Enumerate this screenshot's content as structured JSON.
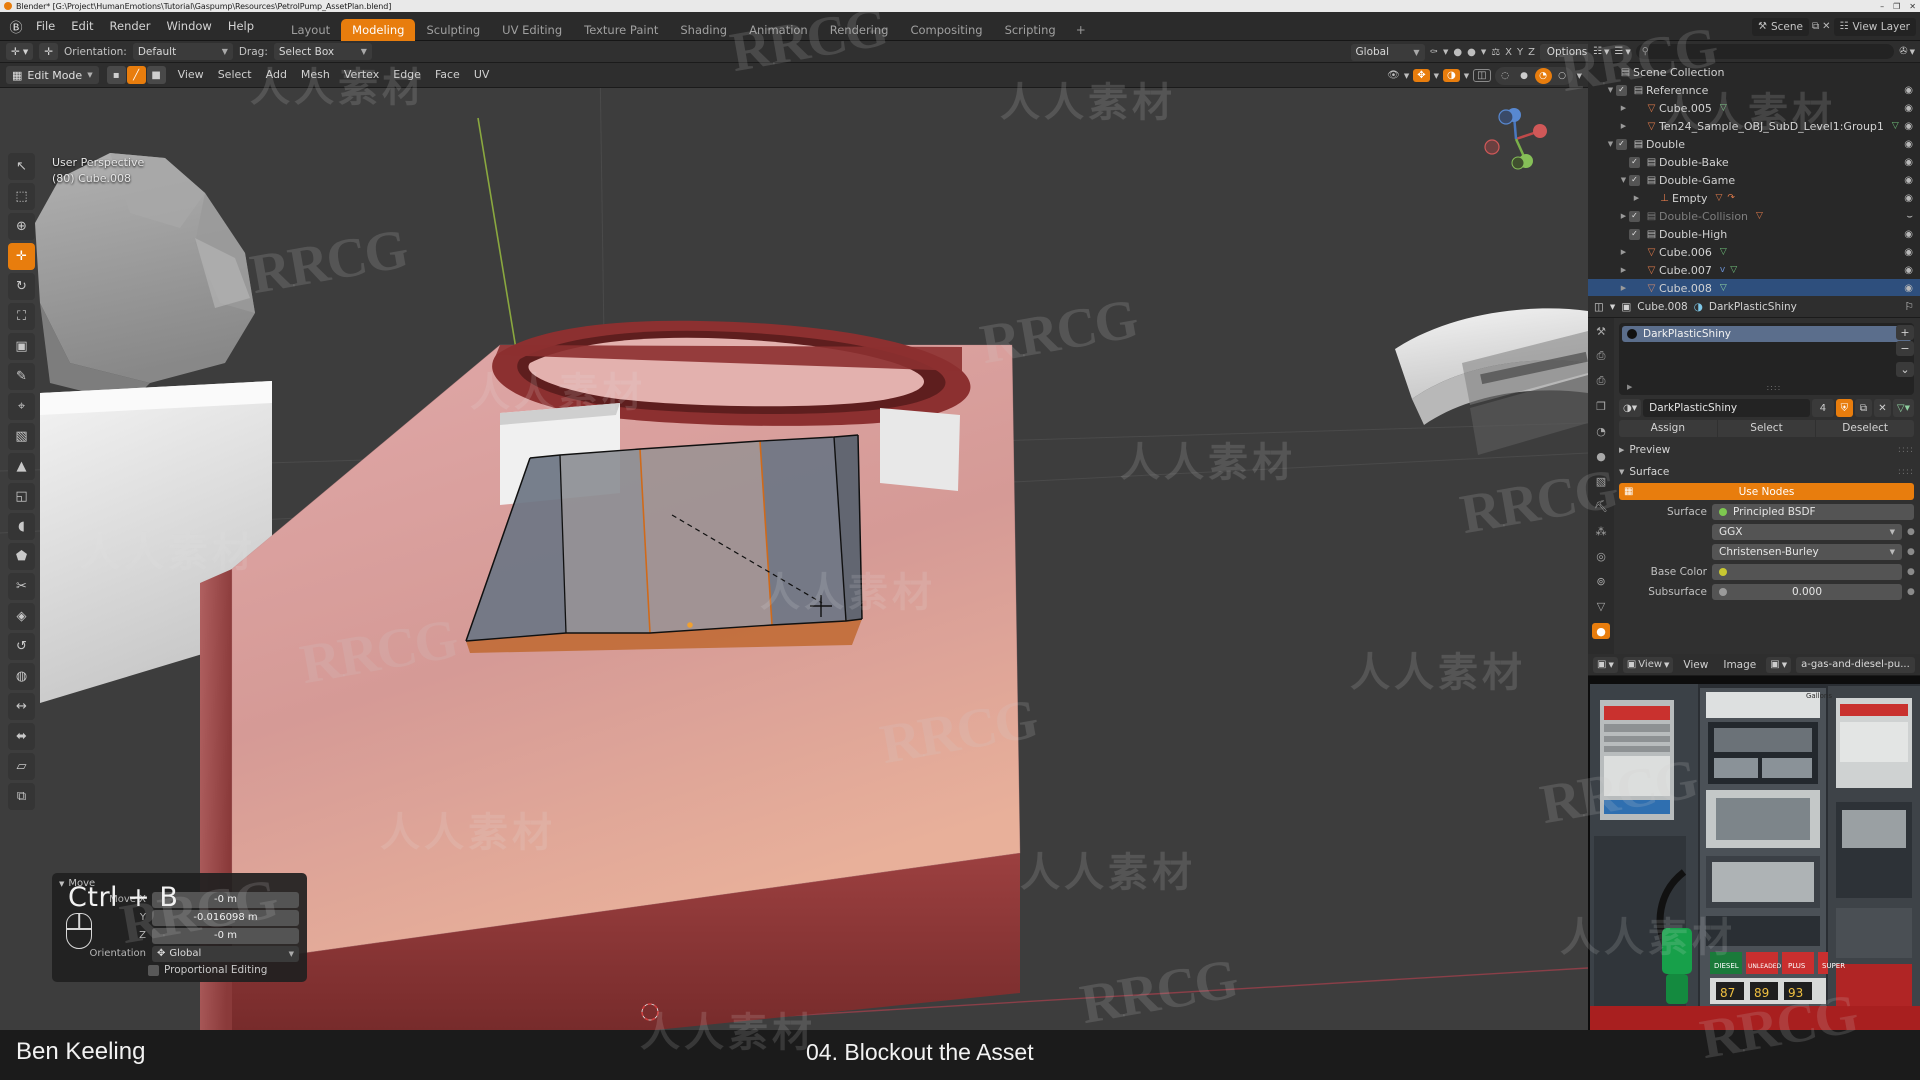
{
  "window": {
    "title": "Blender* [G:\\Project\\HumanEmotions\\Tutorial\\Gaspump\\Resources\\PetrolPump_AssetPlan.blend]",
    "minimize": "–",
    "maximize": "❐",
    "close": "✕"
  },
  "topbar": {
    "logo": "Ⓑ",
    "menus": [
      "File",
      "Edit",
      "Render",
      "Window",
      "Help"
    ],
    "workspaces": [
      {
        "label": "Layout",
        "active": false
      },
      {
        "label": "Modeling",
        "active": true
      },
      {
        "label": "Sculpting",
        "active": false
      },
      {
        "label": "UV Editing",
        "active": false
      },
      {
        "label": "Texture Paint",
        "active": false
      },
      {
        "label": "Shading",
        "active": false
      },
      {
        "label": "Animation",
        "active": false
      },
      {
        "label": "Rendering",
        "active": false
      },
      {
        "label": "Compositing",
        "active": false
      },
      {
        "label": "Scripting",
        "active": false
      }
    ],
    "add_workspace": "+",
    "scene_icon": "⚒",
    "scene_name": "Scene",
    "new_scene": "⧉",
    "remove_scene": "✕",
    "viewlayer_icon": "☷",
    "viewlayer_name": "View Layer"
  },
  "toolsettings": {
    "active_tool_icon": "move-tool-icon",
    "transform_icon": "✛",
    "orientation_label": "Orientation:",
    "orientation_value": "Default",
    "drag_label": "Drag:",
    "drag_value": "Select Box",
    "global_value": "Global",
    "snap_icon": "🧲",
    "proportional_icon": "●",
    "options_label": "Options",
    "xyz": [
      "X",
      "Y",
      "Z"
    ],
    "mirror_icon": "⚖"
  },
  "viewport": {
    "mode": "Edit Mode",
    "select_modes": [
      {
        "name": "vertex-select",
        "glyph": "▪",
        "active": false
      },
      {
        "name": "edge-select",
        "glyph": "╱",
        "active": true
      },
      {
        "name": "face-select",
        "glyph": "■",
        "active": false
      }
    ],
    "menus": [
      "View",
      "Select",
      "Add",
      "Mesh",
      "Vertex",
      "Edge",
      "Face",
      "UV"
    ],
    "overlay_line1": "User Perspective",
    "overlay_line2": "(80) Cube.008",
    "shading_modes": [
      {
        "name": "wireframe-shading",
        "glyph": "◌",
        "active": false
      },
      {
        "name": "solid-shading",
        "glyph": "●",
        "active": false
      },
      {
        "name": "material-preview-shading",
        "glyph": "◔",
        "active": true
      },
      {
        "name": "rendered-shading",
        "glyph": "○",
        "active": false
      }
    ],
    "toolbar_tools": [
      {
        "name": "tweak-tool",
        "glyph": "↖",
        "active": false
      },
      {
        "name": "select-box-tool",
        "glyph": "⬚",
        "active": false
      },
      {
        "name": "cursor-tool",
        "glyph": "⊕",
        "active": false
      },
      {
        "name": "move-tool",
        "glyph": "✛",
        "active": true
      },
      {
        "name": "rotate-tool",
        "glyph": "↻",
        "active": false
      },
      {
        "name": "scale-tool",
        "glyph": "⛶",
        "active": false
      },
      {
        "name": "transform-tool",
        "glyph": "▣",
        "active": false
      },
      {
        "name": "annotate-tool",
        "glyph": "✎",
        "active": false
      },
      {
        "name": "measure-tool",
        "glyph": "⌖",
        "active": false
      },
      {
        "name": "add-cube-tool",
        "glyph": "▧",
        "active": false
      },
      {
        "name": "extrude-region-tool",
        "glyph": "▲",
        "active": false
      },
      {
        "name": "inset-faces-tool",
        "glyph": "◱",
        "active": false
      },
      {
        "name": "bevel-tool",
        "glyph": "◖",
        "active": false
      },
      {
        "name": "loop-cut-tool",
        "glyph": "⬟",
        "active": false
      },
      {
        "name": "knife-tool",
        "glyph": "✂",
        "active": false
      },
      {
        "name": "poly-build-tool",
        "glyph": "◈",
        "active": false
      },
      {
        "name": "spin-tool",
        "glyph": "↺",
        "active": false
      },
      {
        "name": "smooth-tool",
        "glyph": "◍",
        "active": false
      },
      {
        "name": "edge-slide-tool",
        "glyph": "↔",
        "active": false
      },
      {
        "name": "shrink-fatten-tool",
        "glyph": "⬌",
        "active": false
      },
      {
        "name": "shear-tool",
        "glyph": "▱",
        "active": false
      },
      {
        "name": "rip-region-tool",
        "glyph": "⧉",
        "active": false
      }
    ]
  },
  "operator_panel": {
    "title": "Move",
    "shortcut": "Ctrl + B",
    "rows": [
      {
        "label": "Move X",
        "value": "-0 m"
      },
      {
        "label": "Y",
        "value": "-0.016098 m"
      },
      {
        "label": "Z",
        "value": "-0 m"
      }
    ],
    "orientation_label": "Orientation",
    "orientation_value": "Global",
    "proportional_label": "Proportional Editing",
    "proportional_checked": false
  },
  "outliner": {
    "display_mode_icon": "☷",
    "filter_icon": "✇",
    "search_placeholder": "",
    "search_icon": "⚲",
    "root": "Scene Collection",
    "rows": [
      {
        "indent": 0,
        "disclosure": "",
        "checkbox": null,
        "type_icon": "▤",
        "icon_color": "#b9b9b9",
        "name": "Scene Collection",
        "extras": [],
        "eye": "",
        "selected": false,
        "dim": false
      },
      {
        "indent": 1,
        "disclosure": "▼",
        "checkbox": true,
        "type_icon": "▤",
        "icon_color": "#b9b9b9",
        "name": "Referennce",
        "extras": [],
        "eye": "◉",
        "selected": false,
        "dim": false
      },
      {
        "indent": 2,
        "disclosure": "▶",
        "checkbox": null,
        "type_icon": "▽",
        "icon_color": "#e07a4a",
        "name": "Cube.005",
        "extras": [
          {
            "g": "▽",
            "c": "#6fbf7a"
          }
        ],
        "eye": "◉",
        "selected": false,
        "dim": false
      },
      {
        "indent": 2,
        "disclosure": "▶",
        "checkbox": null,
        "type_icon": "▽",
        "icon_color": "#e07a4a",
        "name": "Ten24_Sample_OBJ_SubD_Level1:Group1",
        "extras": [
          {
            "g": "▽",
            "c": "#6fbf7a"
          }
        ],
        "eye": "◉",
        "selected": false,
        "dim": false
      },
      {
        "indent": 1,
        "disclosure": "▼",
        "checkbox": true,
        "type_icon": "▤",
        "icon_color": "#c9c9c9",
        "name": "Double",
        "extras": [],
        "eye": "◉",
        "selected": false,
        "dim": false
      },
      {
        "indent": 2,
        "disclosure": "",
        "checkbox": true,
        "type_icon": "▤",
        "icon_color": "#b9b9b9",
        "name": "Double-Bake",
        "extras": [],
        "eye": "◉",
        "selected": false,
        "dim": false
      },
      {
        "indent": 2,
        "disclosure": "▼",
        "checkbox": true,
        "type_icon": "▤",
        "icon_color": "#b9b9b9",
        "name": "Double-Game",
        "extras": [],
        "eye": "◉",
        "selected": false,
        "dim": false
      },
      {
        "indent": 3,
        "disclosure": "▶",
        "checkbox": null,
        "type_icon": "⊥",
        "icon_color": "#e07a4a",
        "name": "Empty",
        "extras": [
          {
            "g": "▽",
            "c": "#e07a4a"
          },
          {
            "g": "↷",
            "c": "#e07a4a"
          }
        ],
        "eye": "◉",
        "selected": false,
        "dim": false
      },
      {
        "indent": 2,
        "disclosure": "▶",
        "checkbox": true,
        "type_icon": "▤",
        "icon_color": "#7e7e7e",
        "name": "Double-Collision",
        "extras": [
          {
            "g": "▽",
            "c": "#e07a4a"
          }
        ],
        "eye": "⌣",
        "selected": false,
        "dim": true
      },
      {
        "indent": 2,
        "disclosure": "",
        "checkbox": true,
        "type_icon": "▤",
        "icon_color": "#b9b9b9",
        "name": "Double-High",
        "extras": [],
        "eye": "◉",
        "selected": false,
        "dim": false
      },
      {
        "indent": 2,
        "disclosure": "▶",
        "checkbox": null,
        "type_icon": "▽",
        "icon_color": "#e07a4a",
        "name": "Cube.006",
        "extras": [
          {
            "g": "▽",
            "c": "#6fbf7a"
          }
        ],
        "eye": "◉",
        "selected": false,
        "dim": false
      },
      {
        "indent": 2,
        "disclosure": "▶",
        "checkbox": null,
        "type_icon": "▽",
        "icon_color": "#e07a4a",
        "name": "Cube.007",
        "extras": [
          {
            "g": "ᴠ",
            "c": "#6a8fd0"
          },
          {
            "g": "▽",
            "c": "#6fbf7a"
          }
        ],
        "eye": "◉",
        "selected": false,
        "dim": false
      },
      {
        "indent": 2,
        "disclosure": "▶",
        "checkbox": null,
        "type_icon": "▽",
        "icon_color": "#d08a6a",
        "name": "Cube.008",
        "extras": [
          {
            "g": "▽",
            "c": "#8fd0a0"
          }
        ],
        "eye": "◉",
        "selected": true,
        "dim": false
      }
    ]
  },
  "properties": {
    "editor_icon": "⚙",
    "breadcrumb_object_icon": "▣",
    "breadcrumb_object": "Cube.008",
    "breadcrumb_material_icon": "◑",
    "breadcrumb_material": "DarkPlasticShiny",
    "pin_icon": "⚐",
    "tabs": [
      {
        "name": "tool-tab",
        "glyph": "⚒",
        "active": false
      },
      {
        "name": "render-tab",
        "glyph": "⎙",
        "active": false
      },
      {
        "name": "output-tab",
        "glyph": "⎙",
        "active": false
      },
      {
        "name": "view-layer-tab",
        "glyph": "❐",
        "active": false
      },
      {
        "name": "scene-tab",
        "glyph": "◔",
        "active": false
      },
      {
        "name": "world-tab",
        "glyph": "●",
        "active": false
      },
      {
        "name": "object-tab",
        "glyph": "▧",
        "active": false
      },
      {
        "name": "modifier-tab",
        "glyph": "⛏",
        "active": false
      },
      {
        "name": "particles-tab",
        "glyph": "⁂",
        "active": false
      },
      {
        "name": "physics-tab",
        "glyph": "◎",
        "active": false
      },
      {
        "name": "constraints-tab",
        "glyph": "⊚",
        "active": false
      },
      {
        "name": "data-tab",
        "glyph": "▽",
        "active": false
      },
      {
        "name": "material-tab",
        "glyph": "●",
        "active": true
      }
    ],
    "slots": [
      {
        "name": "DarkPlasticShiny",
        "selected": true
      }
    ],
    "slot_controls": [
      "+",
      "−",
      "⌄"
    ],
    "material_name": "DarkPlasticShiny",
    "material_users": "4",
    "fake_user_icon": "⛨",
    "copy_icon": "⧉",
    "unlink_icon": "✕",
    "datablock_icon": "▽",
    "assign_buttons": [
      "Assign",
      "Select",
      "Deselect"
    ],
    "sections": [
      {
        "label": "Preview",
        "expanded": false
      },
      {
        "label": "Surface",
        "expanded": true
      }
    ],
    "use_nodes": "Use Nodes",
    "surface_label": "Surface",
    "surface_value": "Principled BSDF",
    "surface_dot": "#7ec850",
    "distribution": "GGX",
    "subsurface_method": "Christensen-Burley",
    "base_color_label": "Base Color",
    "base_color_dot": "#c8c832",
    "subsurface_label": "Subsurface",
    "subsurface_value": "0.000",
    "subsurface_dot": "#9a9a9a"
  },
  "image_editor": {
    "editor_icon": "▣",
    "mode_icon": "▣",
    "mode_value": "View",
    "menus": [
      "View",
      "Image"
    ],
    "image_icon": "▣",
    "image_name": "a-gas-and-diesel-pu...",
    "photo_labels": [
      "Gallons",
      "DIESEL",
      "UNLEADED",
      "PLUS",
      "SUPER",
      "87",
      "89",
      "93"
    ]
  },
  "caption": {
    "author": "Ben Keeling",
    "lesson": "04. Blockout the Asset"
  },
  "watermarks": {
    "latin": "RRCG",
    "cjk": "人人素材"
  },
  "colors": {
    "accent": "#e87d0d",
    "selection_blue": "#2e4f7d",
    "bg_dark": "#1d1d1d",
    "panel": "#303030",
    "viewport_bg": "#3d3d3d",
    "mesh_pink": "#d9a0a0",
    "mesh_dark_red": "#7a2f2f"
  }
}
